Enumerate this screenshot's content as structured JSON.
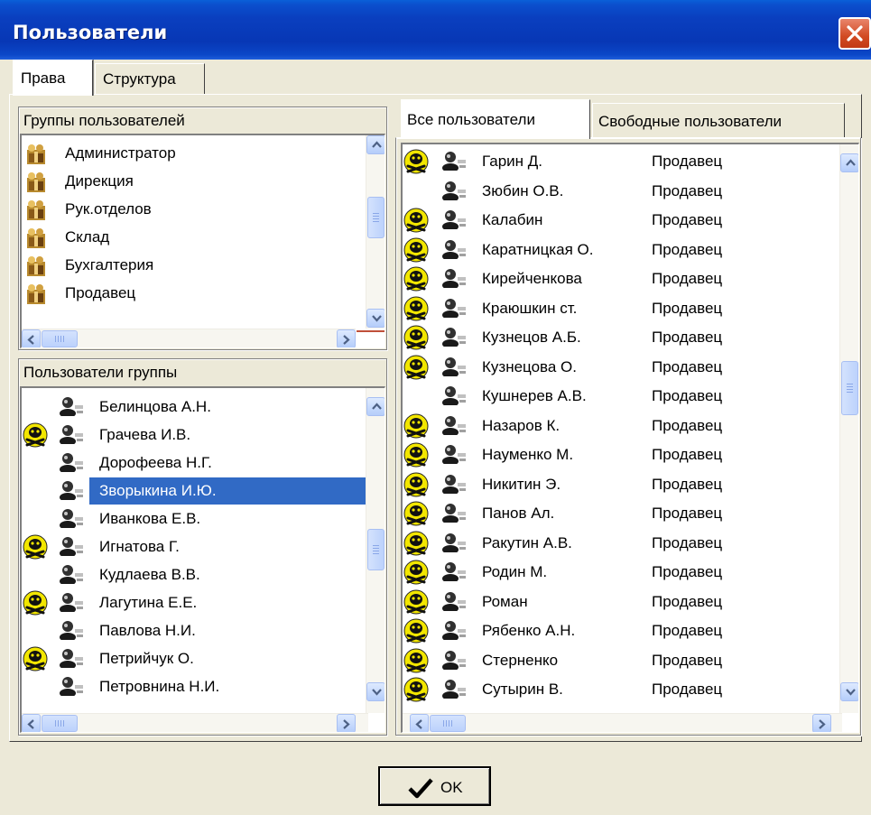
{
  "window": {
    "title": "Пользователи"
  },
  "tabs": [
    "Права",
    "Структура"
  ],
  "groups_panel": {
    "label": "Группы пользователей",
    "items": [
      "Администратор",
      "Дирекция",
      "Рук.отделов",
      "Склад",
      "Бухгалтерия",
      "Продавец"
    ]
  },
  "group_users_panel": {
    "label": "Пользователи группы",
    "items": [
      {
        "name": "Белинцова А.Н.",
        "marked": false
      },
      {
        "name": "Грачева И.В.",
        "marked": true
      },
      {
        "name": "Дорофеева Н.Г.",
        "marked": false
      },
      {
        "name": "Зворыкина И.Ю.",
        "marked": false,
        "selected": true
      },
      {
        "name": "Иванкова Е.В.",
        "marked": false
      },
      {
        "name": "Игнатова Г.",
        "marked": true
      },
      {
        "name": "Кудлаева В.В.",
        "marked": false
      },
      {
        "name": "Лагутина Е.Е.",
        "marked": true
      },
      {
        "name": "Павлова Н.И.",
        "marked": false
      },
      {
        "name": "Петрийчук О.",
        "marked": true
      },
      {
        "name": "Петровнина Н.И.",
        "marked": false
      }
    ]
  },
  "right_tabs": [
    "Все пользователи",
    "Свободные пользователи"
  ],
  "all_users": [
    {
      "name": "Гарин Д.",
      "role": "Продавец",
      "marked": true
    },
    {
      "name": "Зюбин О.В.",
      "role": "Продавец",
      "marked": false
    },
    {
      "name": "Калабин",
      "role": "Продавец",
      "marked": true
    },
    {
      "name": "Каратницкая О.",
      "role": "Продавец",
      "marked": true
    },
    {
      "name": "Кирейченкова",
      "role": "Продавец",
      "marked": true
    },
    {
      "name": "Краюшкин ст.",
      "role": "Продавец",
      "marked": true
    },
    {
      "name": "Кузнецов А.Б.",
      "role": "Продавец",
      "marked": true
    },
    {
      "name": "Кузнецова О.",
      "role": "Продавец",
      "marked": true
    },
    {
      "name": "Кушнерев А.В.",
      "role": "Продавец",
      "marked": false
    },
    {
      "name": "Назаров К.",
      "role": "Продавец",
      "marked": true
    },
    {
      "name": "Науменко М.",
      "role": "Продавец",
      "marked": true
    },
    {
      "name": "Никитин Э.",
      "role": "Продавец",
      "marked": true
    },
    {
      "name": "Панов Ал.",
      "role": "Продавец",
      "marked": true
    },
    {
      "name": "Ракутин А.В.",
      "role": "Продавец",
      "marked": true
    },
    {
      "name": "Родин М.",
      "role": "Продавец",
      "marked": true
    },
    {
      "name": "Роман",
      "role": "Продавец",
      "marked": true
    },
    {
      "name": "Рябенко А.Н.",
      "role": "Продавец",
      "marked": true
    },
    {
      "name": "Стерненко",
      "role": "Продавец",
      "marked": true
    },
    {
      "name": "Сутырин В.",
      "role": "Продавец",
      "marked": true
    }
  ],
  "buttons": {
    "ok": "OK"
  },
  "colors": {
    "titlebar": "#0a3fbf",
    "selection": "#316ac5",
    "face": "#ece9d8",
    "mark_yellow": "#f2e600"
  },
  "icons": {
    "close": "close-icon",
    "group": "group-icon",
    "person": "user-icon",
    "mark": "skull-mark-icon",
    "ok": "checkmark-icon"
  }
}
